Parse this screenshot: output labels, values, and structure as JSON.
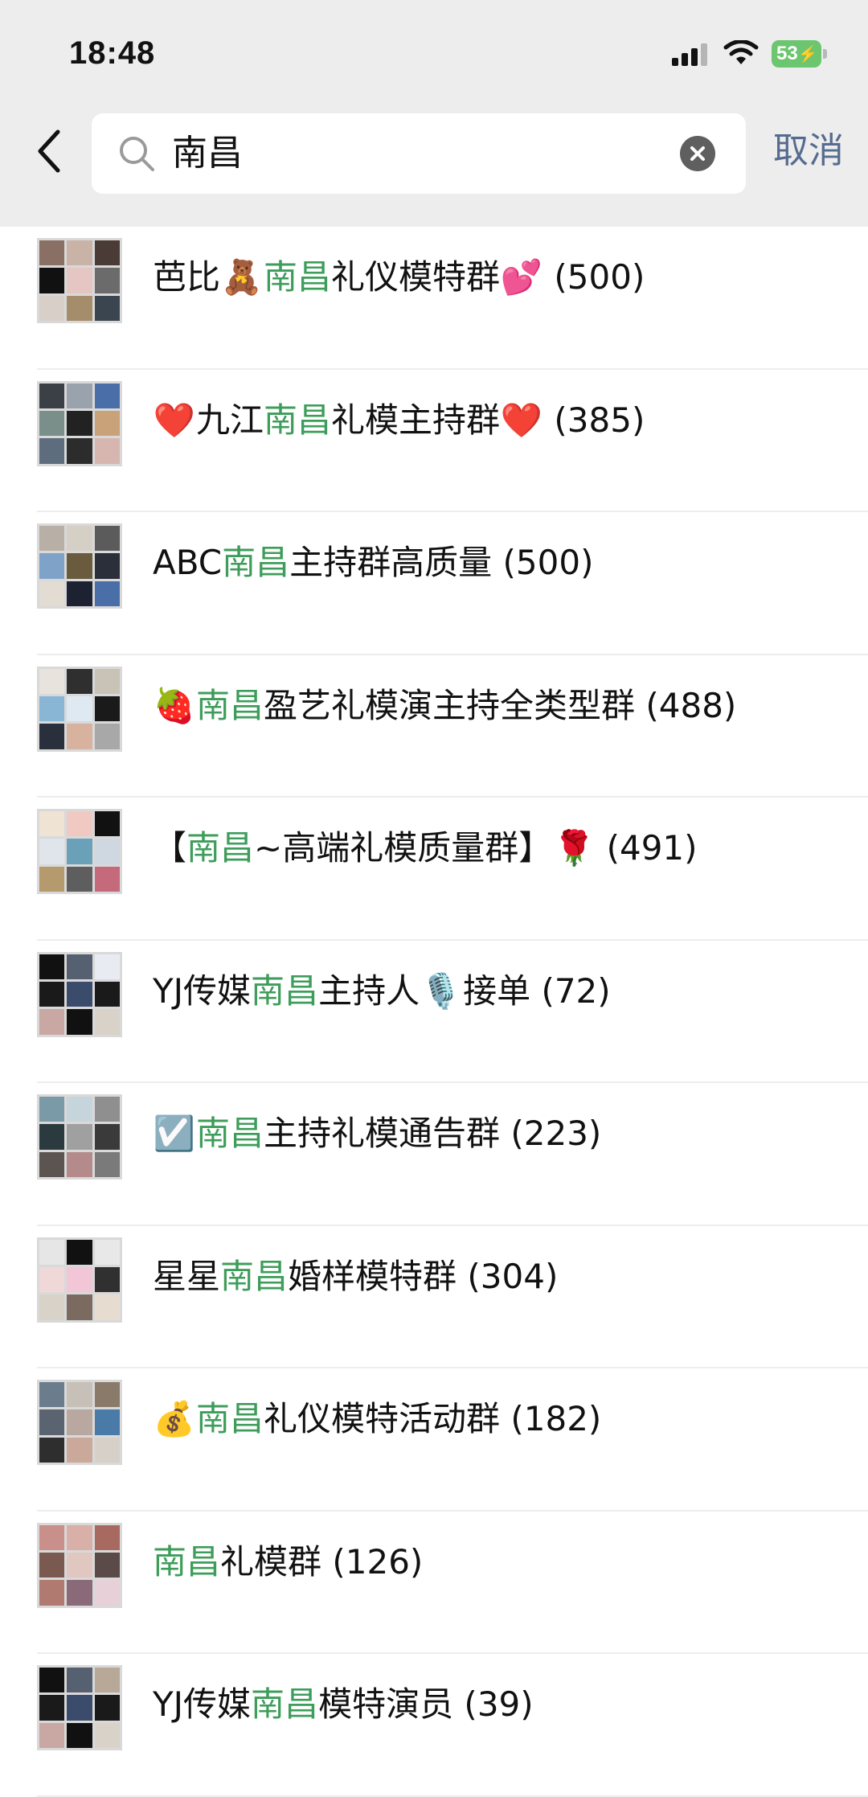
{
  "status_bar": {
    "time": "18:48",
    "battery": "53"
  },
  "search": {
    "value": "南昌",
    "cancel_label": "取消"
  },
  "results": [
    {
      "pre": "芭比",
      "pre_emoji": "🧸",
      "keyword": "南昌",
      "post": "礼仪模特群",
      "post_emoji": "💕",
      "count": " (500)"
    },
    {
      "pre": "",
      "pre_emoji": "❤️",
      "keyword": "南昌",
      "pre2": "九江",
      "post": "礼模主持群",
      "post_emoji": "❤️",
      "count": " (385)"
    },
    {
      "pre": "ABC",
      "pre_emoji": "",
      "keyword": "南昌",
      "post": "主持群高质量",
      "post_emoji": "",
      "count": " (500)"
    },
    {
      "pre": "",
      "pre_emoji": "🍓",
      "keyword": "南昌",
      "post": "盈艺礼模演主持全类型群",
      "post_emoji": "",
      "count": " (488)"
    },
    {
      "pre": "【",
      "pre_emoji": "",
      "keyword": "南昌",
      "post": "~高端礼模质量群】",
      "post_emoji": "🌹",
      "count": " (491)"
    },
    {
      "pre": "YJ传媒",
      "pre_emoji": "",
      "keyword": "南昌",
      "post": "主持人",
      "post_emoji": "🎙️",
      "post2": "接单",
      "count": " (72)"
    },
    {
      "pre": "",
      "pre_emoji": "☑️",
      "keyword": "南昌",
      "post": "主持礼模通告群",
      "post_emoji": "",
      "count": " (223)"
    },
    {
      "pre": "星星",
      "pre_emoji": "",
      "keyword": "南昌",
      "post": "婚样模特群",
      "post_emoji": "",
      "count": " (304)"
    },
    {
      "pre": "",
      "pre_emoji": "💰",
      "keyword": "南昌",
      "post": "礼仪模特活动群",
      "post_emoji": "",
      "count": " (182)"
    },
    {
      "pre": "",
      "pre_emoji": "",
      "keyword": "南昌",
      "post": "礼模群",
      "post_emoji": "",
      "count": " (126)"
    },
    {
      "pre": "YJ传媒",
      "pre_emoji": "",
      "keyword": "南昌",
      "post": "模特演员",
      "post_emoji": "",
      "count": " (39)"
    }
  ],
  "colors": {
    "highlight": "#3e9d5a",
    "cancel": "#566c8f",
    "header_bg": "#ededed"
  }
}
